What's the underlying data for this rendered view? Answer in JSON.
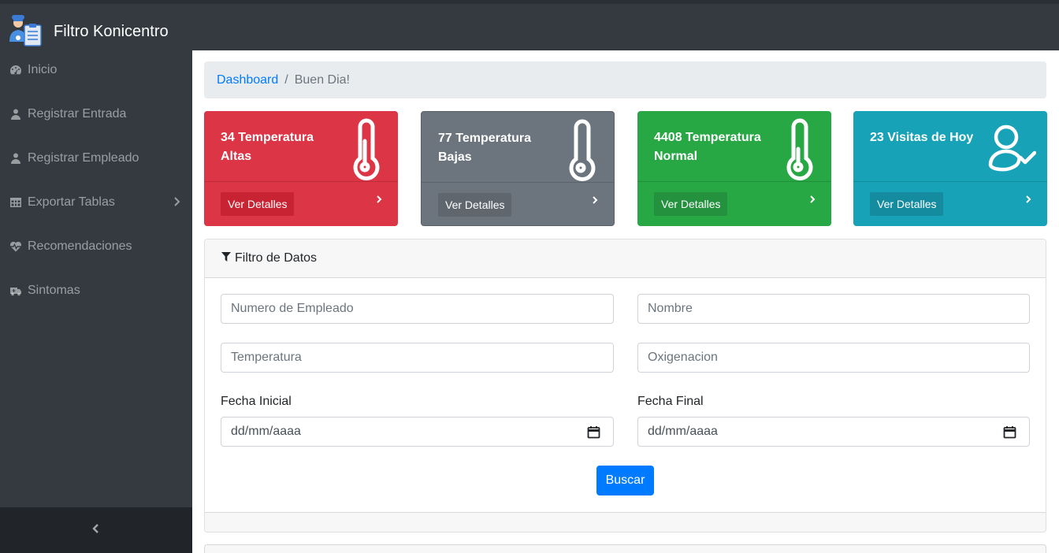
{
  "app": {
    "title": "Filtro Konicentro",
    "logo_icon": "doctor-clipboard-icon"
  },
  "sidebar": {
    "items": [
      {
        "label": "Inicio",
        "icon": "dashboard-icon"
      },
      {
        "label": "Registrar Entrada",
        "icon": "user-icon"
      },
      {
        "label": "Registrar Empleado",
        "icon": "user-icon"
      },
      {
        "label": "Exportar Tablas",
        "icon": "table-icon",
        "has_submenu": true
      },
      {
        "label": "Recomendaciones",
        "icon": "heartbeat-icon"
      },
      {
        "label": "Sintomas",
        "icon": "ambulance-icon"
      }
    ],
    "toggle_icon": "chevron-left-icon"
  },
  "breadcrumb": {
    "link": "Dashboard",
    "separator": "/",
    "current": "Buen Dia!"
  },
  "cards": [
    {
      "title": "34 Temperatura Altas",
      "icon": "thermometer-icon",
      "button": "Ver Detalles",
      "color": "#dc3545"
    },
    {
      "title": "77 Temperatura Bajas",
      "icon": "thermometer-icon",
      "button": "Ver Detalles",
      "color": "#6c757d"
    },
    {
      "title": "4408 Temperatura Normal",
      "icon": "thermometer-icon",
      "button": "Ver Detalles",
      "color": "#28a745"
    },
    {
      "title": "23 Visitas de Hoy",
      "icon": "user-check-icon",
      "button": "Ver Detalles",
      "color": "#17a2b8"
    }
  ],
  "filter": {
    "header": "Filtro de Datos",
    "header_icon": "filter-icon",
    "fields": {
      "employee_number": {
        "placeholder": "Numero de Empleado"
      },
      "name": {
        "placeholder": "Nombre"
      },
      "temperature": {
        "placeholder": "Temperatura"
      },
      "oxygenation": {
        "placeholder": "Oxigenacion"
      }
    },
    "start_date": {
      "label": "Fecha Inicial",
      "value": "dd/mm/aaaa"
    },
    "end_date": {
      "label": "Fecha Final",
      "value": "dd/mm/aaaa"
    },
    "search_button": "Buscar"
  },
  "colors": {
    "primary": "#007bff",
    "sidebar": "#343a40",
    "breadcrumb_bg": "#e9ecef"
  }
}
